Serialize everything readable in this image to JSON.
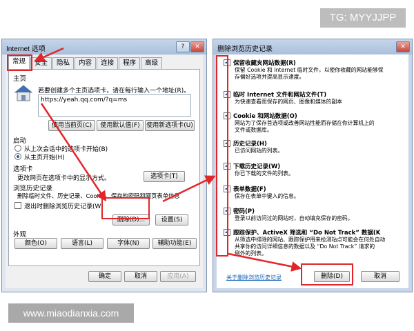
{
  "watermarks": {
    "top": "TG: MYYJJPP",
    "bottom": "www.miaodianxia.com"
  },
  "left_dialog": {
    "title": "Internet 选项",
    "tabs": [
      "常规",
      "安全",
      "隐私",
      "内容",
      "连接",
      "程序",
      "高级"
    ],
    "homepage": {
      "group": "主页",
      "hint": "若要创建多个主页选项卡，请在每行输入一个地址(R)。",
      "url": "https://yeah.qq.com/?q=ms",
      "buttons": [
        "使用当前页(C)",
        "使用默认值(F)",
        "使用新选项卡(U)"
      ]
    },
    "startup": {
      "group": "启动",
      "options": [
        "从上次会话中的选项卡开始(B)",
        "从主页开始(H)"
      ]
    },
    "tabs_section": {
      "group": "选项卡",
      "desc": "更改网页在选项卡中的显示方式。",
      "button": "选项卡(T)"
    },
    "history": {
      "group": "浏览历史记录",
      "desc": "删除临时文件、历史记录、Cookie、保存的密码和网页表单信息",
      "checkbox": "退出时删除浏览历史记录(W)",
      "delete_button": "删除(D)...",
      "settings_button": "设置(S)"
    },
    "appearance": {
      "group": "外观",
      "buttons": [
        "颜色(O)",
        "语言(L)",
        "字体(N)",
        "辅助功能(E)"
      ]
    },
    "footer": {
      "ok": "确定",
      "cancel": "取消",
      "apply": "应用(A)"
    }
  },
  "right_dialog": {
    "title": "删除浏览历史记录",
    "items": [
      {
        "title": "保留收藏夹网站数据(R)",
        "desc": [
          "保留 Cookie 和 Internet 临时文件，以使你收藏的网站能够保",
          "存偏好选项并提高显示速度。"
        ],
        "checked": true
      },
      {
        "title": "临时 Internet 文件和网站文件(T)",
        "desc": [
          "为快速查看而保存的网页、图像和媒体的副本"
        ],
        "checked": true
      },
      {
        "title": "Cookie 和网站数据(O)",
        "desc": [
          "网站为了保存首选项或改善网站性能而存储在你计算机上的",
          "文件或数据库。"
        ],
        "checked": true
      },
      {
        "title": "历史记录(H)",
        "desc": [
          "已访问网站的列表。"
        ],
        "checked": true
      },
      {
        "title": "下载历史记录(W)",
        "desc": [
          "你已下载的文件的列表。"
        ],
        "checked": true
      },
      {
        "title": "表单数据(F)",
        "desc": [
          "保存在表单中键入的信息。"
        ],
        "checked": true
      },
      {
        "title": "密码(P)",
        "desc": [
          "登录以前访问过的网站时，自动填充保存的密码。"
        ],
        "checked": true
      },
      {
        "title": "跟踪保护、ActiveX 筛选和 “Do Not Track” 数据(K",
        "desc": [
          "从筛选中排除的网站、跟踪保护用来检测站点可能会在何处自动",
          "共享你的访问详细信息的数据以及 “Do Not Track” 请求的",
          "例外的列表。"
        ],
        "checked": true
      }
    ],
    "link": "关于删除浏览历史记录",
    "delete_button": "删除(D)",
    "cancel_button": "取消"
  },
  "colors": {
    "annotation_red": "#e0262a",
    "link_blue": "#0b5fb4",
    "titlebar": "#b7cbe4"
  }
}
